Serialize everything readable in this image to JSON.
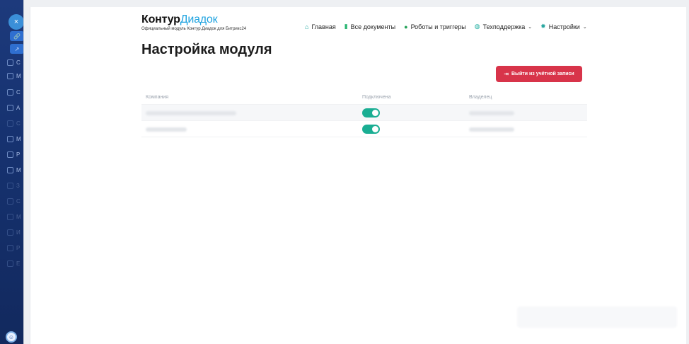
{
  "left_panel": {
    "close_label": "×",
    "items": [
      {
        "icon": "bitrix-icon",
        "label": "C"
      },
      {
        "icon": "grid-icon",
        "label": "M"
      },
      {
        "icon": "doc-icon",
        "label": "C"
      },
      {
        "icon": "chat-icon",
        "label": "A"
      },
      {
        "icon": "clock-icon",
        "label": "C"
      },
      {
        "icon": "calendar-icon",
        "label": "M"
      },
      {
        "icon": "code-icon",
        "label": "P"
      },
      {
        "icon": "table-icon",
        "label": "M"
      },
      {
        "icon": "list-icon",
        "label": "З"
      },
      {
        "icon": "user-icon",
        "label": "C"
      },
      {
        "icon": "chart-icon",
        "label": "M"
      },
      {
        "icon": "settings-icon",
        "label": "И"
      },
      {
        "icon": "folder-icon",
        "label": "Р"
      },
      {
        "icon": "more-icon",
        "label": "Е"
      }
    ]
  },
  "header": {
    "logo_brand": "Контур",
    "logo_product": "Диадок",
    "logo_subtitle": "Официальный модуль Контур.Диадок для Битрикс24",
    "nav": [
      {
        "icon": "home-icon",
        "label": "Главная",
        "has_caret": false
      },
      {
        "icon": "document-icon",
        "label": "Все документы",
        "has_caret": false
      },
      {
        "icon": "robot-icon",
        "label": "Роботы и триггеры",
        "has_caret": false
      },
      {
        "icon": "support-icon",
        "label": "Техподдержка",
        "has_caret": true
      },
      {
        "icon": "gear-icon",
        "label": "Настройки",
        "has_caret": true
      }
    ]
  },
  "page": {
    "title": "Настройка модуля",
    "logout_label": "Выйти из учётной записи"
  },
  "table": {
    "headers": [
      "Компания",
      "Подключена",
      "Владелец"
    ],
    "rows": [
      {
        "connected": true
      },
      {
        "connected": true
      }
    ]
  },
  "colors": {
    "accent": "#1fa3e0",
    "danger": "#d8344a",
    "toggle_on": "#1aae93",
    "sidebar": "#163270"
  }
}
